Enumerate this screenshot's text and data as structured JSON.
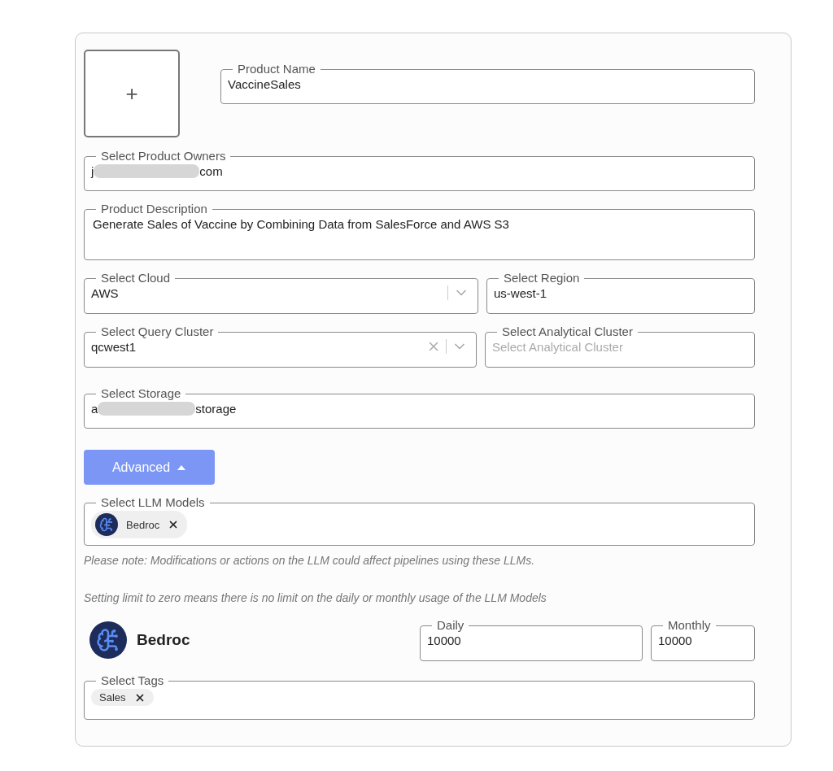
{
  "image_upload": {
    "symbol": "+"
  },
  "product_name": {
    "label": "Product Name",
    "value": "VaccineSales"
  },
  "product_owners": {
    "label": "Select Product Owners",
    "value_start": "j",
    "value_end": "com"
  },
  "description": {
    "label": "Product Description",
    "value": "Generate Sales of Vaccine by Combining Data from SalesForce and AWS S3"
  },
  "cloud": {
    "label": "Select Cloud",
    "value": "AWS"
  },
  "region": {
    "label": "Select Region",
    "value": "us-west-1"
  },
  "query_cluster": {
    "label": "Select Query Cluster",
    "value": "qcwest1",
    "clearable": true
  },
  "analytical_cluster": {
    "label": "Select Analytical Cluster",
    "placeholder": "Select Analytical Cluster"
  },
  "storage": {
    "label": "Select Storage",
    "value_start": "a",
    "value_end": "storage"
  },
  "advanced_button": {
    "label": "Advanced",
    "expanded": true
  },
  "llm_models": {
    "label": "Select LLM Models",
    "chips": [
      {
        "label": "Bedroc",
        "kind": "model"
      }
    ]
  },
  "notes": [
    "Please note: Modifications or actions on the LLM could affect pipelines using these LLMs.",
    "Setting limit to zero means there is no limit on the daily or monthly usage of the LLM Models"
  ],
  "model_limits": [
    {
      "name": "Bedroc",
      "daily": {
        "label": "Daily",
        "value": "10000"
      },
      "monthly": {
        "label": "Monthly",
        "value": "10000"
      }
    }
  ],
  "tags": {
    "label": "Select Tags",
    "chips": [
      {
        "label": "Sales",
        "kind": "tag"
      }
    ]
  }
}
